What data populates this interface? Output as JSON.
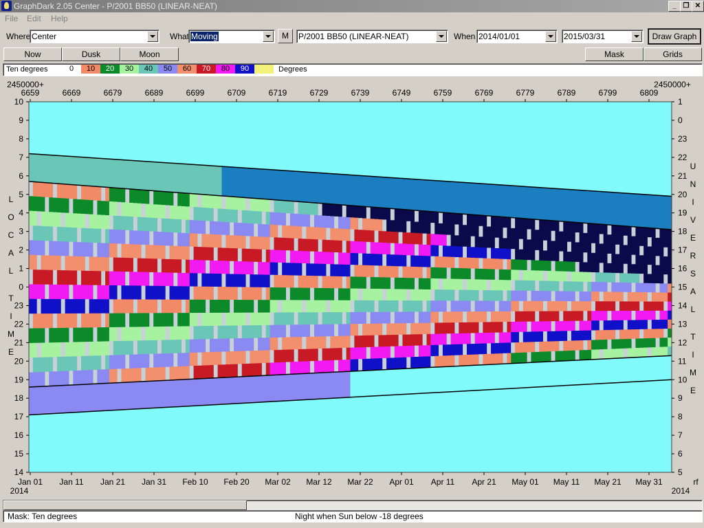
{
  "window": {
    "title": "GraphDark 2.05  Center  -  P/2001 BB50 (LINEAR-NEAT)",
    "min_label": "_",
    "max_label": "❐",
    "close_label": "✕"
  },
  "menu": {
    "file": "File",
    "edit": "Edit",
    "help": "Help"
  },
  "toolbar": {
    "where_label": "Where",
    "where_value": "Center",
    "what_label": "What",
    "what_value": "Moving",
    "m_button": "M",
    "object_value": "P/2001 BB50 (LINEAR-NEAT)",
    "when_label": "When",
    "from_date": "2014/01/01",
    "to_date": "2015/03/31",
    "draw_button": "Draw Graph"
  },
  "buttons": {
    "now": "Now",
    "dusk": "Dusk",
    "moon": "Moon",
    "mask": "Mask",
    "grids": "Grids"
  },
  "legend": {
    "title": "Ten degrees",
    "unit": "Degrees",
    "swatches": [
      {
        "label": "0",
        "color": "#ffffff"
      },
      {
        "label": "10",
        "color": "#f28a68"
      },
      {
        "label": "20",
        "color": "#0c8a2a"
      },
      {
        "label": "30",
        "color": "#a6f2a0"
      },
      {
        "label": "40",
        "color": "#6ac6b6"
      },
      {
        "label": "50",
        "color": "#8a8af2"
      },
      {
        "label": "60",
        "color": "#f2906e"
      },
      {
        "label": "70",
        "color": "#c81a24"
      },
      {
        "label": "80",
        "color": "#f21af2"
      },
      {
        "label": "90",
        "color": "#1010c8"
      },
      {
        "label": "",
        "color": "#f2f27a"
      }
    ]
  },
  "chart_data": {
    "type": "heatmap",
    "jd_prefix_left": "2450000+",
    "jd_prefix_right": "2450000+",
    "jd_ticks": [
      "6659",
      "6669",
      "6679",
      "6689",
      "6699",
      "6709",
      "6719",
      "6729",
      "6739",
      "6749",
      "6759",
      "6769",
      "6779",
      "6789",
      "6799",
      "6809"
    ],
    "date_ticks": [
      "Jan 01",
      "Jan 11",
      "Jan 21",
      "Jan 31",
      "Feb 10",
      "Feb 20",
      "Mar 02",
      "Mar 12",
      "Mar 22",
      "Apr 01",
      "Apr 11",
      "Apr 21",
      "May 01",
      "May 11",
      "May 21",
      "May 31"
    ],
    "year_left": "2014",
    "year_right": "2014",
    "right_end_label": "rf",
    "left_axis_title": "LOCAL TIME",
    "right_axis_title": "UNIVERSAL TIME",
    "left_ticks": [
      "10",
      "9",
      "8",
      "7",
      "6",
      "5",
      "4",
      "3",
      "2",
      "1",
      "0",
      "23",
      "22",
      "21",
      "20",
      "19",
      "18",
      "17",
      "16",
      "15",
      "14"
    ],
    "right_ticks": [
      "1",
      "0",
      "23",
      "22",
      "21",
      "20",
      "19",
      "18",
      "17",
      "16",
      "15",
      "14",
      "13",
      "12",
      "11",
      "10",
      "9",
      "8",
      "7",
      "6",
      "5"
    ],
    "background_color": "#80fafa",
    "twilight_color": "#1a7ec0",
    "below_horizon_color": "#0a0a4a",
    "moon_color": "#c8d0d8",
    "morning_twilight_start": [
      7.2,
      4.9
    ],
    "night_end_morning": [
      5.7,
      3.1
    ],
    "night_start_evening": [
      18.6,
      20.3
    ],
    "evening_twilight_end": [
      17.1,
      19.0
    ],
    "altitude_step_degrees": 10
  },
  "status": {
    "mask_text": "Mask:  Ten degrees",
    "night_text": "Night when Sun below -18 degrees"
  }
}
